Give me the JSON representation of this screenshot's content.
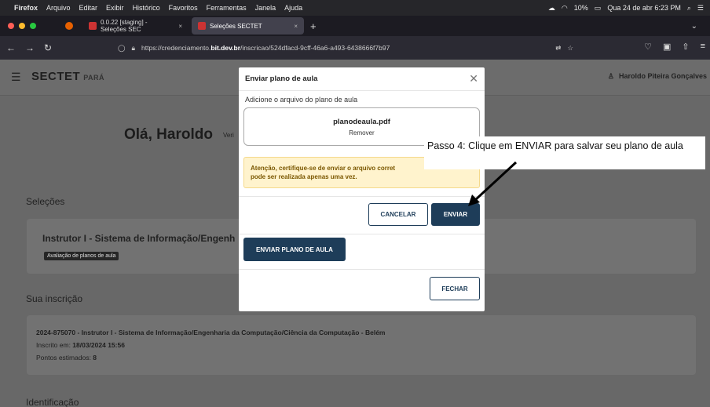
{
  "menubar": {
    "app": "Firefox",
    "items": [
      "Arquivo",
      "Editar",
      "Exibir",
      "Histórico",
      "Favoritos",
      "Ferramentas",
      "Janela",
      "Ajuda"
    ],
    "battery": "10%",
    "datetime": "Qua 24 de abr 6:23 PM"
  },
  "tabs": {
    "inactive_title": "0.0.22 [staging] - Seleções SEC",
    "active_title": "Seleções SECTET"
  },
  "navbar": {
    "url_prefix": "https://credenciamento.",
    "url_domain": "bit.dev.br",
    "url_path": "/inscricao/524dfacd-9cff-46a6-a493-6438666f7b97"
  },
  "app": {
    "logo": "SECTET",
    "logo_sub": "PARÁ",
    "user": "Haroldo Piteira Gonçalves",
    "greeting": "Olá, Haroldo",
    "greeting_sub": "Veri"
  },
  "sections": {
    "selecoes": "Seleções",
    "inscricao": "Sua inscrição",
    "identificacao": "Identificação"
  },
  "selection_card": {
    "title": "Instrutor I - Sistema de Informação/Engenh",
    "badge": "Avaliação de planos de aula"
  },
  "inscription_card": {
    "line1": "2024-875070 - Instrutor I - Sistema de Informação/Engenharia da Computação/Ciência da Computação - Belém",
    "line2_label": "Inscrito em: ",
    "line2_value": "18/03/2024 15:56",
    "line3_label": "Pontos estimados: ",
    "line3_value": "8"
  },
  "modal": {
    "title": "Enviar plano de aula",
    "label": "Adicione o arquivo do plano de aula",
    "filename": "planodeaula.pdf",
    "remove": "Remover",
    "warning_line1": "Atenção, certifique-se de enviar o arquivo corret",
    "warning_line2": "pode ser realizada apenas uma vez.",
    "cancel": "CANCELAR",
    "send": "ENVIAR",
    "send_plan": "ENVIAR PLANO DE AULA",
    "close": "FECHAR"
  },
  "callout": {
    "text": "Passo 4: Clique em ENVIAR para salvar seu plano de aula"
  },
  "colors": {
    "primary": "#1e3d59",
    "warning_bg": "#fff3cd",
    "overlay": "#686868"
  }
}
